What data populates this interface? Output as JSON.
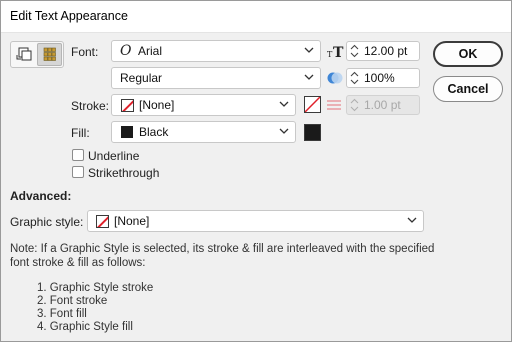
{
  "window": {
    "title": "Edit Text Appearance"
  },
  "font": {
    "label": "Font:",
    "family": "Arial",
    "style": "Regular",
    "size": "12.00 pt",
    "opacity": "100%"
  },
  "stroke": {
    "label": "Stroke:",
    "value": "[None]",
    "weight": "1.00 pt"
  },
  "fill": {
    "label": "Fill:",
    "value": "Black"
  },
  "options": {
    "underline": {
      "label": "Underline",
      "checked": false
    },
    "strikethrough": {
      "label": "Strikethrough",
      "checked": false
    }
  },
  "advanced": {
    "heading": "Advanced:",
    "graphic_style_label": "Graphic style:",
    "graphic_style_value": "[None]"
  },
  "note": {
    "line1": "Note: If a Graphic Style is selected, its stroke & fill are interleaved with the specified",
    "line2": "font stroke & fill as follows:",
    "items": [
      "1. Graphic Style stroke",
      "2. Font stroke",
      "3. Font fill",
      "4. Graphic Style fill"
    ]
  },
  "buttons": {
    "ok": "OK",
    "cancel": "Cancel"
  },
  "colors": {
    "none_slash": "#e0202a",
    "fill_black": "#1a1a1a",
    "stroke_lines": "#e89aa0"
  }
}
